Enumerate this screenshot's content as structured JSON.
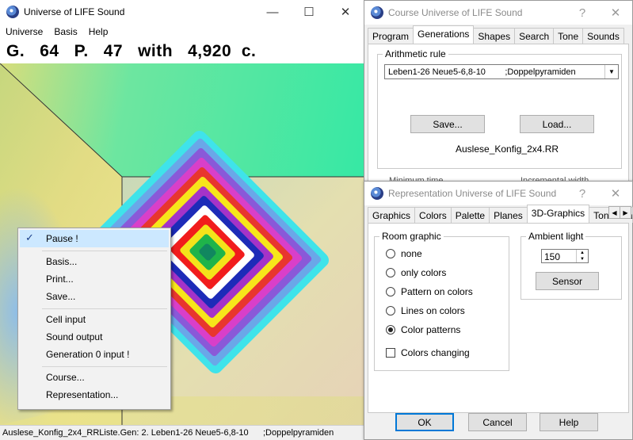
{
  "main_window": {
    "title": "Universe of LIFE Sound",
    "controls": {
      "minimize": "—",
      "maximize": "☐",
      "close": "✕"
    },
    "menu": [
      "Universe",
      "Basis",
      "Help"
    ],
    "stats": {
      "g_label": "G.",
      "g_value": "64",
      "p_label": "P.",
      "p_value": "47",
      "with_label": "with",
      "count": "4,920",
      "unit": "c."
    },
    "status": {
      "left": "Auslese_Konfig_2x4_RRListe.Gen: 2. Leben1-26 Neue5-6,8-10",
      "right": ";Doppelpyramiden"
    }
  },
  "context_menu": {
    "items": [
      {
        "label": "Pause !",
        "checked": true
      },
      {
        "label": "Basis..."
      },
      {
        "label": "Print..."
      },
      {
        "label": "Save..."
      },
      {
        "label": "Cell input"
      },
      {
        "label": "Sound output"
      },
      {
        "label": "Generation 0 input !"
      },
      {
        "label": "Course..."
      },
      {
        "label": "Representation..."
      }
    ],
    "check_glyph": "✓"
  },
  "course_dialog": {
    "title": "Course Universe of LIFE Sound",
    "help": "?",
    "close": "✕",
    "tabs": [
      "Program",
      "Generations",
      "Shapes",
      "Search",
      "Tone",
      "Sounds"
    ],
    "active_tab": "Generations",
    "arithmetic_rule": {
      "legend": "Arithmetic rule",
      "selected": "Leben1-26 Neue5-6,8-10        ;Doppelpyramiden",
      "save": "Save...",
      "load": "Load...",
      "file": "Auslese_Konfig_2x4.RR"
    },
    "partial_labels": [
      "Minimum time",
      "Incremental width"
    ]
  },
  "repr_dialog": {
    "title": "Representation Universe of LIFE Sound",
    "help": "?",
    "close": "✕",
    "tabs": [
      "Graphics",
      "Colors",
      "Palette",
      "Planes",
      "3D-Graphics",
      "Tone Gra"
    ],
    "active_tab": "3D-Graphics",
    "room_graphic": {
      "legend": "Room graphic",
      "options": [
        "none",
        "only colors",
        "Pattern on colors",
        "Lines on colors",
        "Color patterns"
      ],
      "selected": "Color patterns",
      "colors_changing": "Colors changing"
    },
    "ambient_light": {
      "legend": "Ambient light",
      "value": "150",
      "sensor": "Sensor"
    },
    "buttons": {
      "ok": "OK",
      "cancel": "Cancel",
      "help": "Help"
    }
  },
  "colors": {
    "accent": "#0078d7",
    "pyramid_rings": [
      "#3fe3ea",
      "#6aa7e8",
      "#8a59d8",
      "#d93fc9",
      "#e8362e",
      "#f7e61a",
      "#a433c8",
      "#1d2bb8",
      "#ffffff",
      "#f11c1c",
      "#f4e31a",
      "#1fb44a",
      "#11875f"
    ]
  }
}
